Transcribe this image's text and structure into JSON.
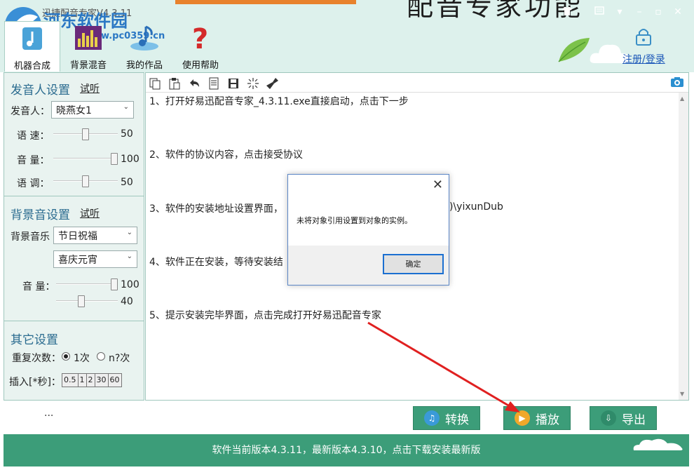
{
  "app": {
    "title": "迅捷配音专家V4.3.11",
    "bg_title": "配音专家功能"
  },
  "watermark": {
    "name": "河东软件园",
    "url": "www.pc0359.cn"
  },
  "toolbar": {
    "items": [
      {
        "label": "机器合成",
        "icon": "microphone-note-icon"
      },
      {
        "label": "背景混音",
        "icon": "equalizer-icon"
      },
      {
        "label": "我的作品",
        "icon": "music-note-icon"
      },
      {
        "label": "使用帮助",
        "icon": "question-icon"
      }
    ],
    "login": "注册/登录"
  },
  "voice_settings": {
    "title": "发音人设置",
    "try": "试听",
    "speaker_label": "发音人：",
    "speaker_value": "晓燕女1",
    "speed_label": "语 速：",
    "speed_value": "50",
    "volume_label": "音 量：",
    "volume_value": "100",
    "tone_label": "语 调：",
    "tone_value": "50"
  },
  "bg_settings": {
    "title": "背景音设置",
    "try": "试听",
    "music_label": "背景音乐",
    "category_value": "节日祝福",
    "track_value": "喜庆元宵",
    "volume_label": "音 量：",
    "volume1_value": "100",
    "volume2_value": "40"
  },
  "other_settings": {
    "title": "其它设置",
    "repeat_label": "重复次数：",
    "repeat_opt1": "1次",
    "repeat_opt2": "n?次",
    "insert_label": "插入[*秒]：",
    "pauses": [
      "0.5",
      "1",
      "2",
      "30",
      "60"
    ]
  },
  "editor": {
    "steps": [
      "1、打开好易迅配音专家_4.3.11.exe直接启动，点击下一步",
      "2、软件的协议内容，点击接受协议",
      "3、软件的安装地址设置界面，",
      "4、软件正在安装，等待安装结",
      "5、提示安装完毕界面，点击完成打开好易迅配音专家"
    ],
    "step3_tail": ")\\yixunDub"
  },
  "dialog": {
    "message": "未将对象引用设置到对象的实例。",
    "ok": "确定"
  },
  "actions": {
    "ellipsis": "...",
    "convert": "转换",
    "play": "播放",
    "export": "导出"
  },
  "status": "软件当前版本4.3.11，最新版本4.3.10，点击下载安装最新版",
  "colors": {
    "accent": "#3c9d79",
    "arrow": "#e02020",
    "link": "#1a56b8"
  },
  "sliders": {
    "speed": 0.5,
    "volume": 1.0,
    "tone": 0.5,
    "bg_volume1": 1.0,
    "bg_volume2": 0.4
  }
}
